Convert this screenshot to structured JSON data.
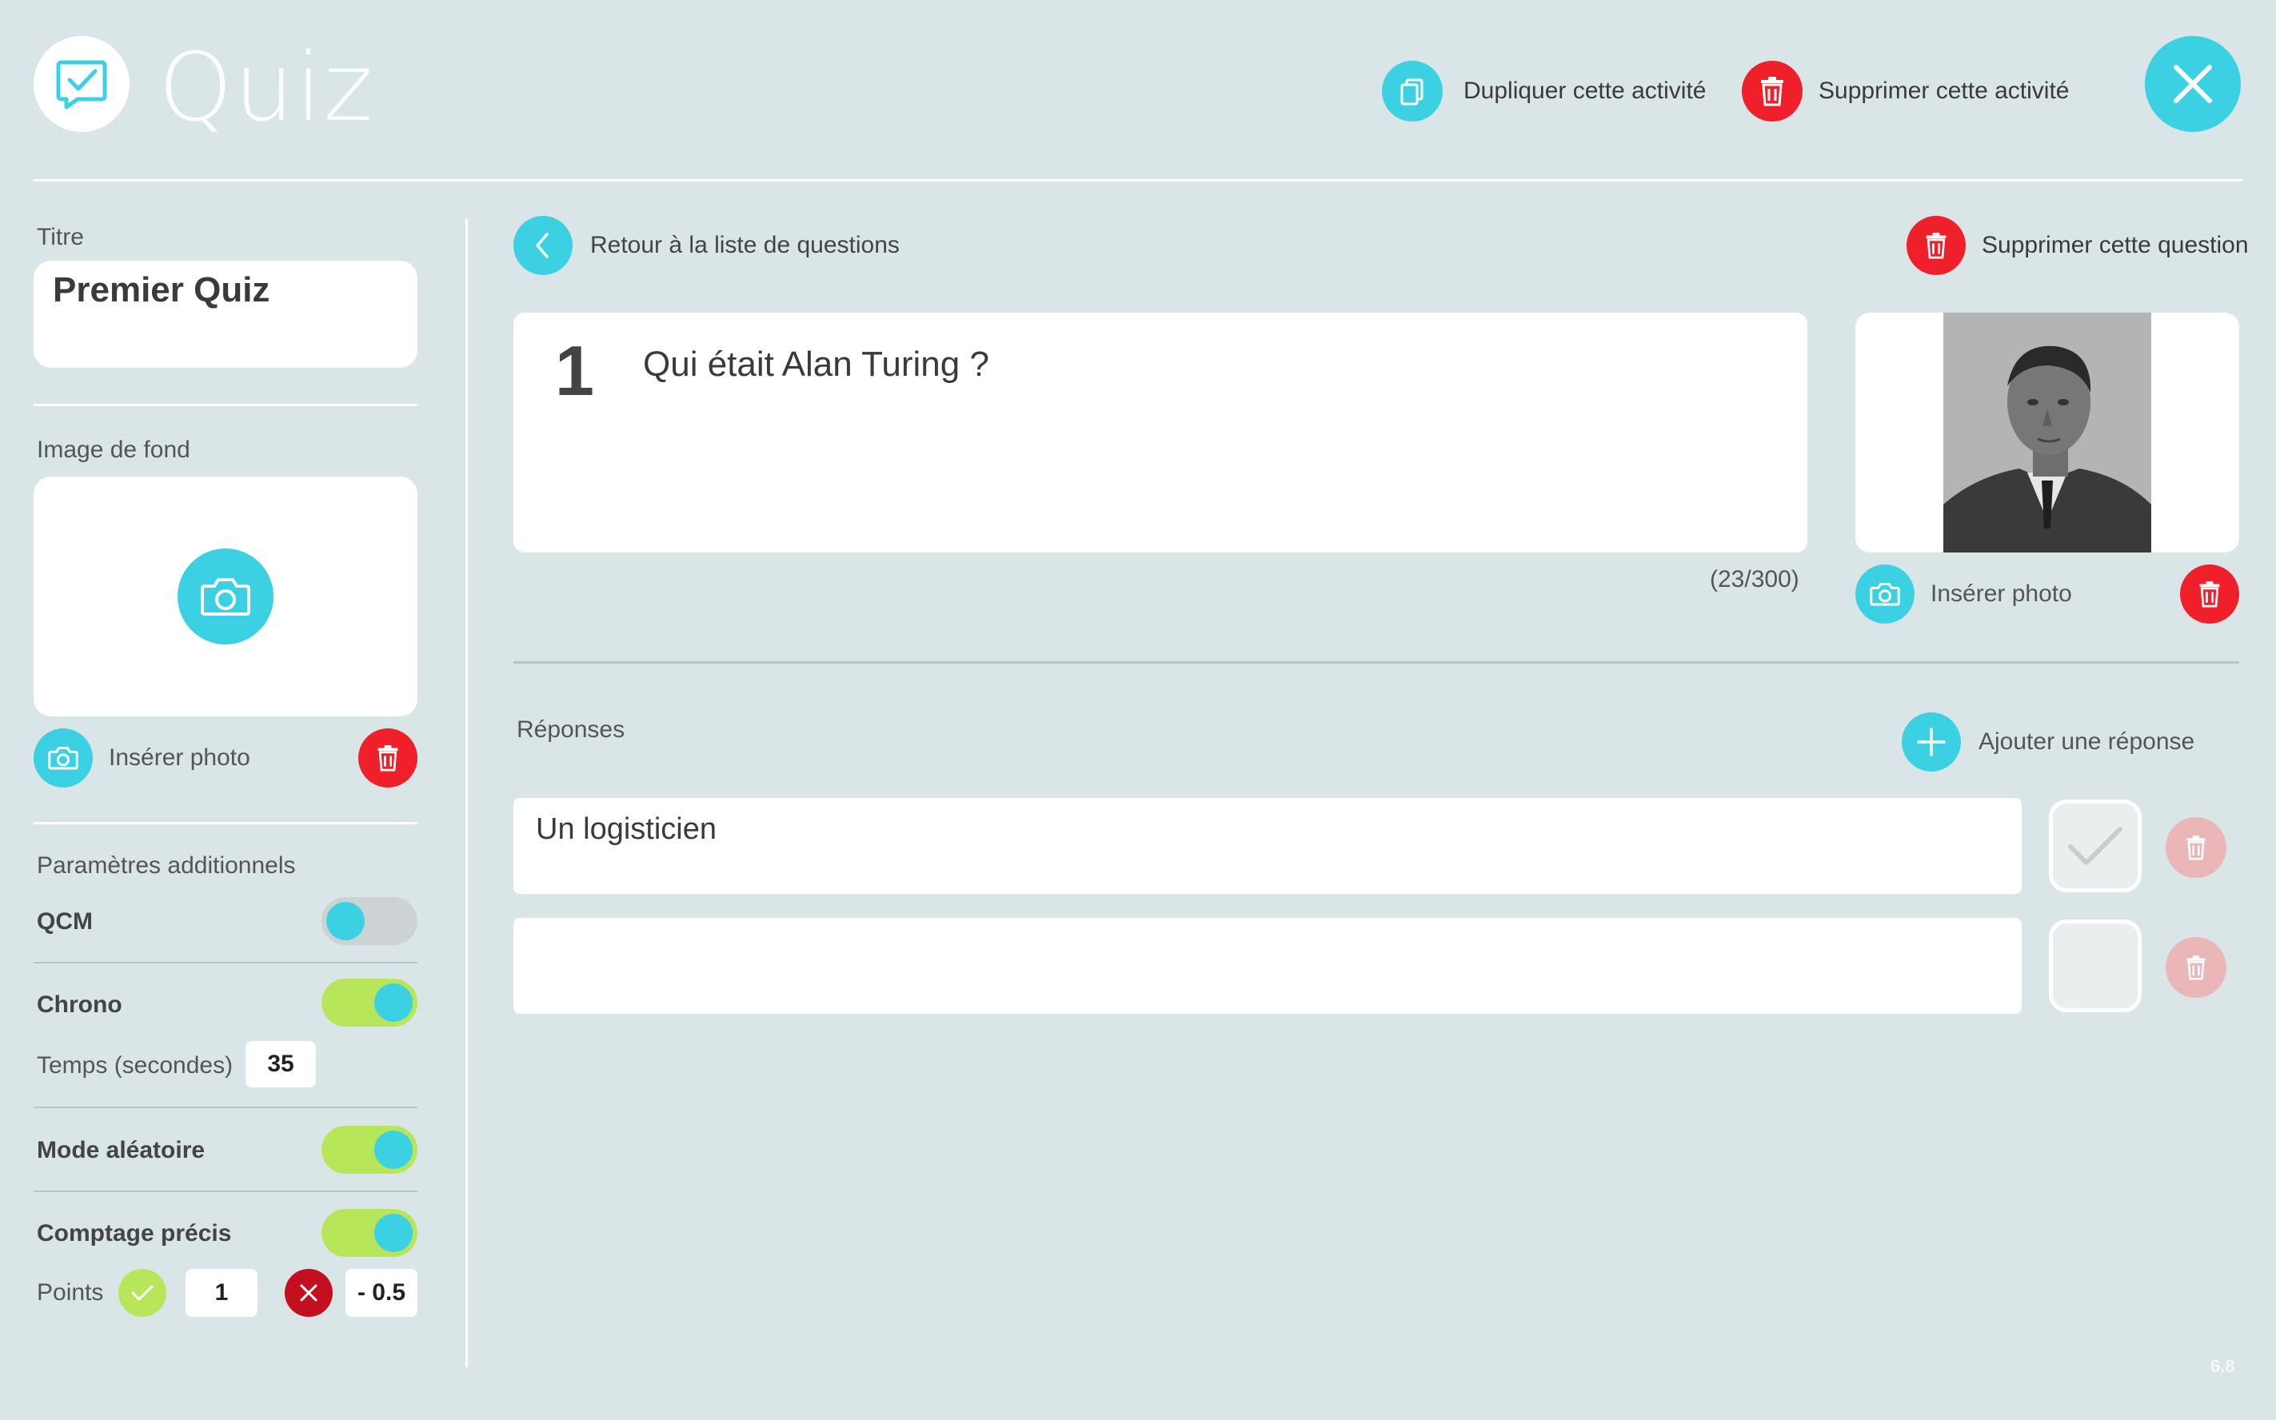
{
  "header": {
    "app_title": "Quiz",
    "duplicate_label": "Dupliquer cette activité",
    "delete_activity_label": "Supprimer cette activité"
  },
  "sidebar": {
    "title_label": "Titre",
    "title_value": "Premier Quiz",
    "background_label": "Image de fond",
    "insert_photo_label": "Insérer photo",
    "additional_label": "Paramètres additionnels",
    "qcm_label": "QCM",
    "qcm_on": false,
    "chrono_label": "Chrono",
    "chrono_on": true,
    "time_label": "Temps (secondes)",
    "time_value": "35",
    "random_label": "Mode aléatoire",
    "random_on": true,
    "precise_label": "Comptage précis",
    "precise_on": true,
    "points_label": "Points",
    "points_correct": "1",
    "points_wrong": "- 0.5"
  },
  "main": {
    "back_label": "Retour à la liste de questions",
    "delete_question_label": "Supprimer cette question",
    "question_number": "1",
    "question_text": "Qui était Alan Turing ?",
    "char_count": "(23/300)",
    "insert_photo_label": "Insérer photo",
    "answers_label": "Réponses",
    "add_answer_label": "Ajouter une réponse",
    "answers": [
      {
        "text": "Un logisticien",
        "correct": true
      },
      {
        "text": "",
        "correct": false
      }
    ]
  },
  "version": "6.8",
  "colors": {
    "background": "#d9e5e7",
    "accent": "#3cd1e2",
    "danger": "#f0202a",
    "toggle_on": "#b8e65a"
  }
}
